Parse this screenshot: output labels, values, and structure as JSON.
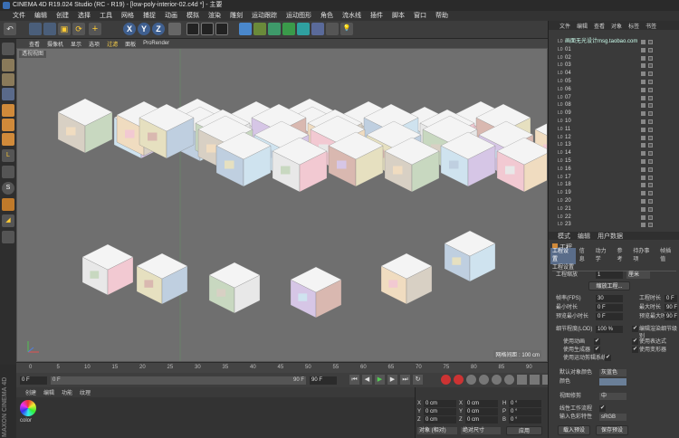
{
  "title": "CINEMA 4D R19.024 Studio (RC - R19) - [low-poly-interior-02.c4d *] - 主要",
  "menu": [
    "文件",
    "编辑",
    "创建",
    "选择",
    "工具",
    "网格",
    "捕捉",
    "动画",
    "模拟",
    "渲染",
    "雕刻",
    "运动跟踪",
    "运动图形",
    "角色",
    "流水线",
    "插件",
    "脚本",
    "窗口",
    "帮助"
  ],
  "toolbar_axes": [
    "X",
    "Y",
    "Z"
  ],
  "viewport_menu": [
    "查看",
    "摄像机",
    "显示",
    "选项",
    "过滤",
    "面板",
    "ProRender"
  ],
  "viewport_label": "透视视图",
  "grid_spacing": "网格间距 : 100 cm",
  "timeline": {
    "start": "0 F",
    "end": "90 F",
    "ticks": [
      "0",
      "5",
      "10",
      "15",
      "20",
      "25",
      "30",
      "35",
      "40",
      "45",
      "50",
      "55",
      "60",
      "65",
      "70",
      "75",
      "80",
      "85",
      "90"
    ]
  },
  "transport": {
    "current": "0 F",
    "field2": "0 F",
    "end": "90 F",
    "end2": "90 F"
  },
  "material_menu": [
    "创建",
    "编辑",
    "功能",
    "纹理"
  ],
  "material_name": "color",
  "maxon_text": "MAXON CINEMA 4D",
  "coords": {
    "rows": [
      {
        "a": "X",
        "v1": "0 cm",
        "b": "X",
        "v2": "0 cm",
        "c": "H",
        "v3": "0 °"
      },
      {
        "a": "Y",
        "v1": "0 cm",
        "b": "Y",
        "v2": "0 cm",
        "c": "P",
        "v3": "0 °"
      },
      {
        "a": "Z",
        "v1": "0 cm",
        "b": "Z",
        "v2": "0 cm",
        "c": "B",
        "v3": "0 °"
      }
    ],
    "mode": "对象 (相对)",
    "size_mode": "绝对尺寸",
    "apply": "应用"
  },
  "object_tabs": [
    "文件",
    "编辑",
    "查看",
    "对象",
    "标签",
    "书签"
  ],
  "objects": [
    "画面无光设计msg.taobao.com",
    "01",
    "02",
    "03",
    "04",
    "05",
    "06",
    "07",
    "08",
    "09",
    "10",
    "11",
    "12",
    "13",
    "14",
    "15",
    "16",
    "17",
    "18",
    "19",
    "20",
    "21",
    "22",
    "23"
  ],
  "attr_tabs": [
    "模式",
    "编辑",
    "用户数据"
  ],
  "project_label": "工程",
  "attr_subtabs": [
    "工程设置",
    "信息",
    "动力学",
    "参考",
    "待办事项",
    "帧插值"
  ],
  "project_settings": "工程设置",
  "fields": {
    "scale_label": "工程缩放",
    "scale": "1",
    "scale_unit": "厘米",
    "scale_btn": "缩放工程...",
    "fps_label": "帧率(FPS)",
    "fps": "30",
    "project_time_label": "工程时长",
    "project_time": "0 F",
    "min_time_label": "最小时长",
    "min_time": "0 F",
    "max_time_label": "最大时长",
    "max_time": "90 F",
    "preview_min_label": "预览最小时长",
    "preview_min": "0 F",
    "preview_max_label": "预览最大时长",
    "preview_max": "90 F",
    "lod_label": "细节程度(LOD)",
    "lod": "100 %",
    "render_lod_label": "编辑渲染细节级别",
    "use_anim": "使用动画",
    "use_expr": "使用表达式",
    "use_gen": "使用生成器",
    "use_deform": "使用变形器",
    "use_motion": "使用运动剪辑系统",
    "default_color_label": "默认对象颜色",
    "default_color": "灰蓝色",
    "color_label": "颜色",
    "view_clip_label": "视图修剪",
    "view_clip": "中",
    "linear_label": "线性工作流程",
    "input_color_label": "输入色彩特性",
    "input_color": "sRGB",
    "load_preset": "载入预设",
    "save_preset": "保存预设"
  },
  "colors": {
    "accent": "#5a6d8a",
    "viewport": "#6f6f6f",
    "active_tab": "#ffd44a"
  }
}
